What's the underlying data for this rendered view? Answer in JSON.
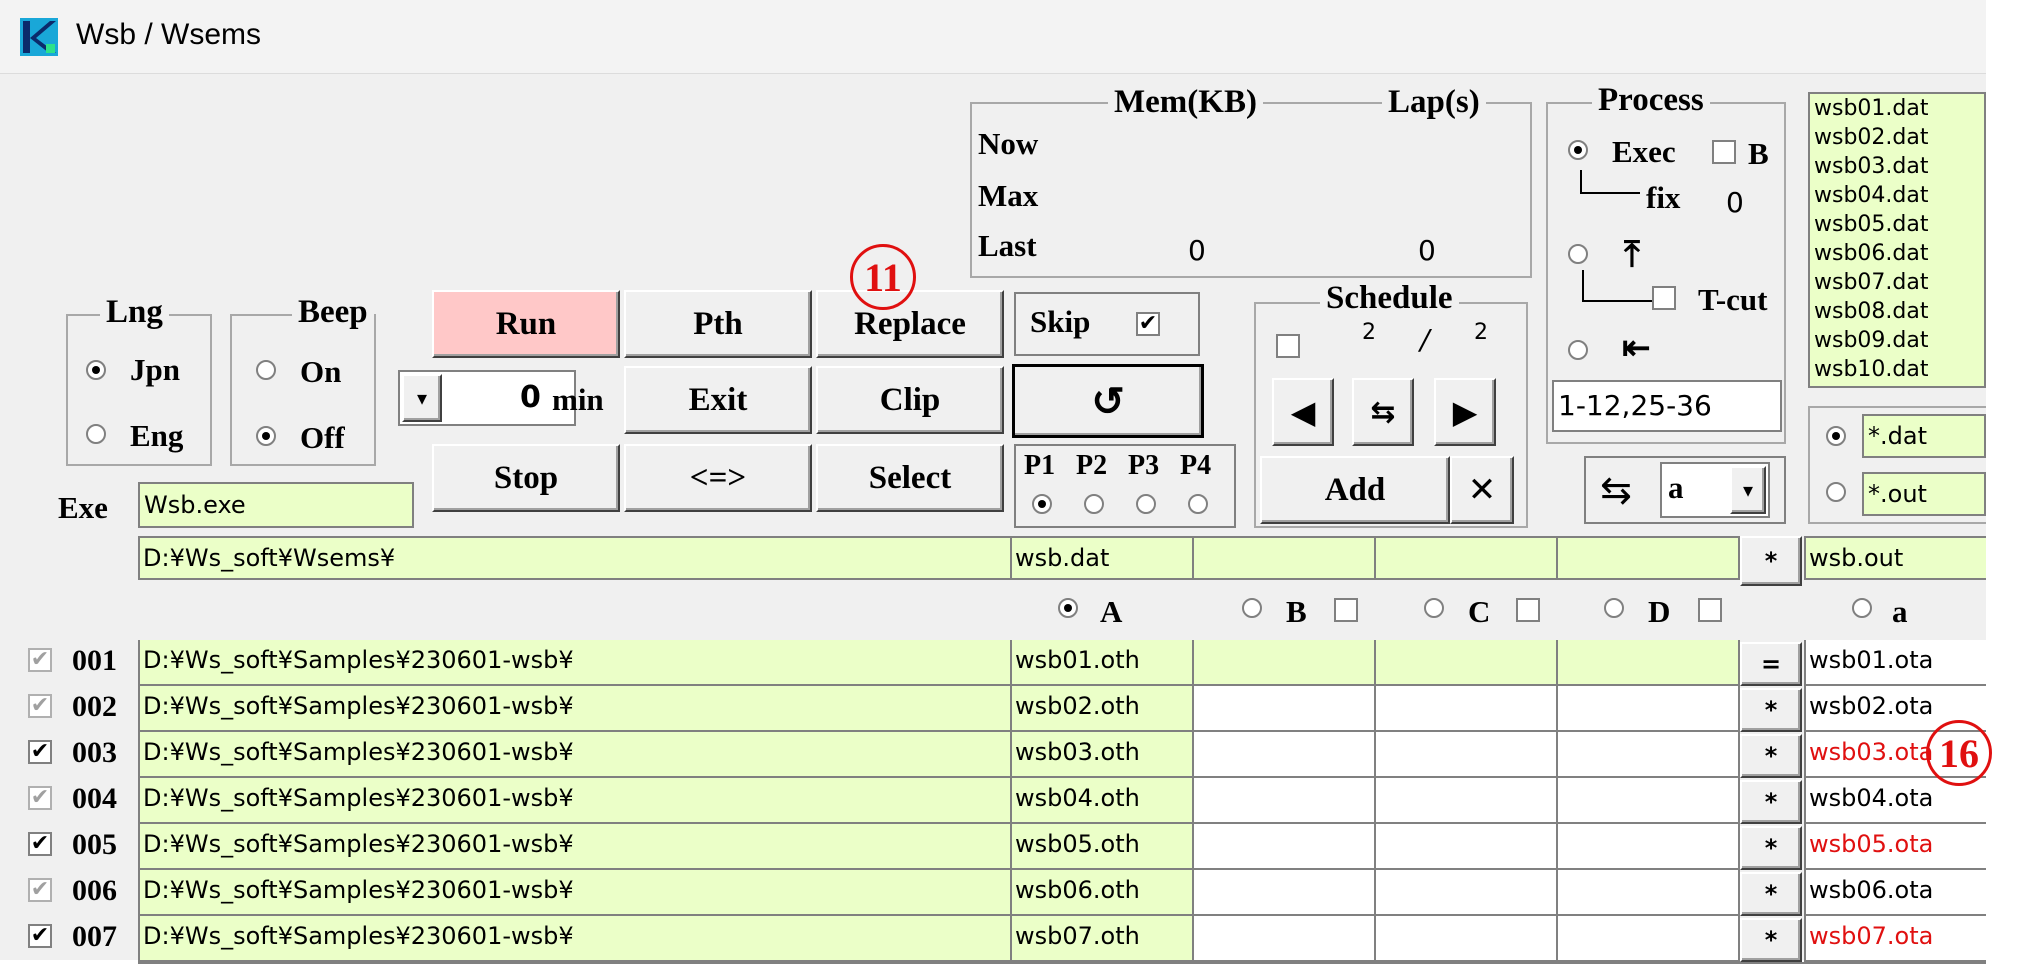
{
  "window": {
    "title": "Wsb / Wsems"
  },
  "colors": {
    "field": "#ebffc8",
    "run": "#ffc8c8",
    "highlight": "#e01010"
  },
  "mem": {
    "legend_mem": "Mem(KB)",
    "legend_lap": "Lap(s)",
    "now": "Now",
    "max": "Max",
    "last": "Last",
    "last_mem": "0",
    "last_lap": "0"
  },
  "process": {
    "legend": "Process",
    "exec": "Exec",
    "b": "B",
    "fix": "fix",
    "fix_value": "0",
    "tcut": "T-cut",
    "range": "1-12,25-36"
  },
  "files": [
    "wsb01.dat",
    "wsb02.dat",
    "wsb03.dat",
    "wsb04.dat",
    "wsb05.dat",
    "wsb06.dat",
    "wsb07.dat",
    "wsb08.dat",
    "wsb09.dat",
    "wsb10.dat"
  ],
  "filters": {
    "dat": "*.dat",
    "out": "*.out"
  },
  "lng": {
    "legend": "Lng",
    "jpn": "Jpn",
    "eng": "Eng"
  },
  "beep": {
    "legend": "Beep",
    "on": "On",
    "off": "Off"
  },
  "buttons": {
    "run": "Run",
    "pth": "Pth",
    "replace": "Replace",
    "exit": "Exit",
    "clip": "Clip",
    "stop": "Stop",
    "swap": "<=>",
    "select": "Select",
    "reload": "↺",
    "add": "Add",
    "close": "✕"
  },
  "skip": {
    "label": "Skip"
  },
  "timer": {
    "value": "0",
    "unit": "min"
  },
  "p": {
    "p1": "P1",
    "p2": "P2",
    "p3": "P3",
    "p4": "P4"
  },
  "schedule": {
    "legend": "Schedule",
    "num": "2",
    "slash": "/",
    "den": "2"
  },
  "sort": {
    "value": "a"
  },
  "exe": {
    "label": "Exe",
    "value": "Wsb.exe"
  },
  "header_row": {
    "path": "D:¥Ws_soft¥Wsems¥",
    "a": "wsb.dat",
    "star": "*",
    "out": "wsb.out"
  },
  "columns": {
    "a": "A",
    "b": "B",
    "c": "C",
    "d": "D",
    "out": "a"
  },
  "annotations": {
    "n11": "11",
    "n16": "16"
  },
  "rows": [
    {
      "num": "001",
      "checked": false,
      "path": "D:¥Ws_soft¥Samples¥230601-wsb¥",
      "a": "wsb01.oth",
      "op": "=",
      "out": "wsb01.ota",
      "red": false
    },
    {
      "num": "002",
      "checked": false,
      "path": "D:¥Ws_soft¥Samples¥230601-wsb¥",
      "a": "wsb02.oth",
      "op": "*",
      "out": "wsb02.ota",
      "red": false
    },
    {
      "num": "003",
      "checked": true,
      "path": "D:¥Ws_soft¥Samples¥230601-wsb¥",
      "a": "wsb03.oth",
      "op": "*",
      "out": "wsb03.ota",
      "red": true
    },
    {
      "num": "004",
      "checked": false,
      "path": "D:¥Ws_soft¥Samples¥230601-wsb¥",
      "a": "wsb04.oth",
      "op": "*",
      "out": "wsb04.ota",
      "red": false
    },
    {
      "num": "005",
      "checked": true,
      "path": "D:¥Ws_soft¥Samples¥230601-wsb¥",
      "a": "wsb05.oth",
      "op": "*",
      "out": "wsb05.ota",
      "red": true
    },
    {
      "num": "006",
      "checked": false,
      "path": "D:¥Ws_soft¥Samples¥230601-wsb¥",
      "a": "wsb06.oth",
      "op": "*",
      "out": "wsb06.ota",
      "red": false
    },
    {
      "num": "007",
      "checked": true,
      "path": "D:¥Ws_soft¥Samples¥230601-wsb¥",
      "a": "wsb07.oth",
      "op": "*",
      "out": "wsb07.ota",
      "red": true
    }
  ]
}
